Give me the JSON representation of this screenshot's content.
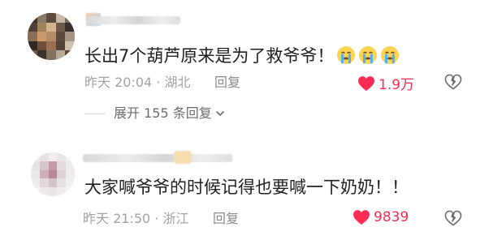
{
  "comments": [
    {
      "text": "长出7个葫芦原来是为了救爷爷！",
      "emoji_count": 3,
      "emoji_name": "loudly-crying-face",
      "time": "昨天 20:04",
      "separator": "·",
      "location": "湖北",
      "reply_label": "回复",
      "likes": "1.9万",
      "liked": true,
      "expand_label": "展开 155 条回复"
    },
    {
      "text": "大家喊爷爷的时候记得也要喊一下奶奶！！",
      "time": "昨天 21:50",
      "separator": "·",
      "location": "浙江",
      "reply_label": "回复",
      "likes": "9839",
      "liked": true
    }
  ],
  "colors": {
    "like": "#fe2c55",
    "meta": "#a3a3a3",
    "text": "#1f1f1f"
  }
}
